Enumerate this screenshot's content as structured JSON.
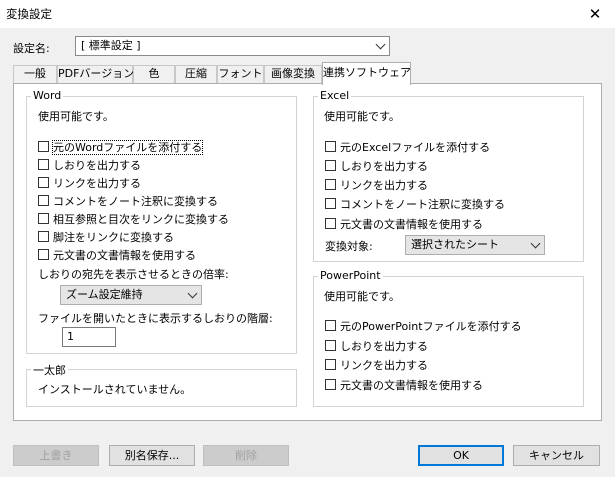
{
  "window": {
    "title": "変換設定",
    "close_label": "✕"
  },
  "settings": {
    "label": "設定名:",
    "value": "[ 標準設定 ]"
  },
  "tabs": [
    {
      "label": "一般"
    },
    {
      "label": "PDFバージョン"
    },
    {
      "label": "色"
    },
    {
      "label": "圧縮"
    },
    {
      "label": "フォント"
    },
    {
      "label": "画像変換"
    },
    {
      "label": "連携ソフトウェア",
      "active": true
    }
  ],
  "word": {
    "title": "Word",
    "status": "使用可能です。",
    "options": [
      {
        "label": "元のWordファイルを添付する",
        "checked": false
      },
      {
        "label": "しおりを出力する",
        "checked": false
      },
      {
        "label": "リンクを出力する",
        "checked": false
      },
      {
        "label": "コメントをノート注釈に変換する",
        "checked": false
      },
      {
        "label": "相互参照と目次をリンクに変換する",
        "checked": false
      },
      {
        "label": "脚注をリンクに変換する",
        "checked": false
      },
      {
        "label": "元文書の文書情報を使用する",
        "checked": false
      }
    ],
    "zoom_label": "しおりの宛先を表示させるときの倍率:",
    "zoom_value": "ズーム設定維持",
    "level_label": "ファイルを開いたときに表示するしおりの階層:",
    "level_value": "1"
  },
  "ichitaro": {
    "title": "一太郎",
    "status": "インストールされていません。"
  },
  "excel": {
    "title": "Excel",
    "status": "使用可能です。",
    "options": [
      {
        "label": "元のExcelファイルを添付する",
        "checked": false
      },
      {
        "label": "しおりを出力する",
        "checked": false
      },
      {
        "label": "リンクを出力する",
        "checked": false
      },
      {
        "label": "コメントをノート注釈に変換する",
        "checked": false
      },
      {
        "label": "元文書の文書情報を使用する",
        "checked": false
      }
    ],
    "target_label": "変換対象:",
    "target_value": "選択されたシート"
  },
  "powerpoint": {
    "title": "PowerPoint",
    "status": "使用可能です。",
    "options": [
      {
        "label": "元のPowerPointファイルを添付する",
        "checked": false
      },
      {
        "label": "しおりを出力する",
        "checked": false
      },
      {
        "label": "リンクを出力する",
        "checked": false
      },
      {
        "label": "元文書の文書情報を使用する",
        "checked": false
      }
    ]
  },
  "buttons": {
    "overwrite": "上書き",
    "save_as": "別名保存...",
    "delete": "削除",
    "ok": "OK",
    "cancel": "キャンセル"
  }
}
